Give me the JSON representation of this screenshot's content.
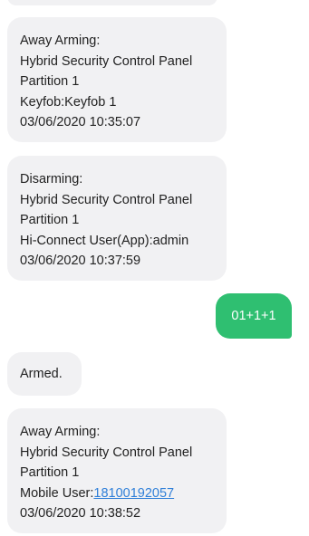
{
  "messages": [
    {
      "type": "received",
      "lines": [
        "Away Arming:",
        "Hybrid Security Control Panel",
        "Partition 1",
        "Keyfob:Keyfob 1",
        "03/06/2020 10:35:07"
      ]
    },
    {
      "type": "received",
      "lines": [
        "Disarming:",
        "Hybrid Security Control Panel",
        "Partition 1",
        "Hi-Connect User(App):admin",
        "03/06/2020 10:37:59"
      ]
    },
    {
      "type": "sent",
      "text": "01+1+1"
    },
    {
      "type": "received",
      "lines": [
        "Armed."
      ]
    },
    {
      "type": "received",
      "lines": [
        "Away Arming:",
        "Hybrid Security Control Panel",
        "Partition 1"
      ],
      "user_prefix": "Mobile User:",
      "user_phone": "18100192057",
      "timestamp": "03/06/2020 10:38:52"
    }
  ],
  "colors": {
    "received_bubble": "#f1f1f3",
    "sent_bubble": "#2fbf71",
    "link": "#2f7fd8",
    "text": "#222222"
  }
}
